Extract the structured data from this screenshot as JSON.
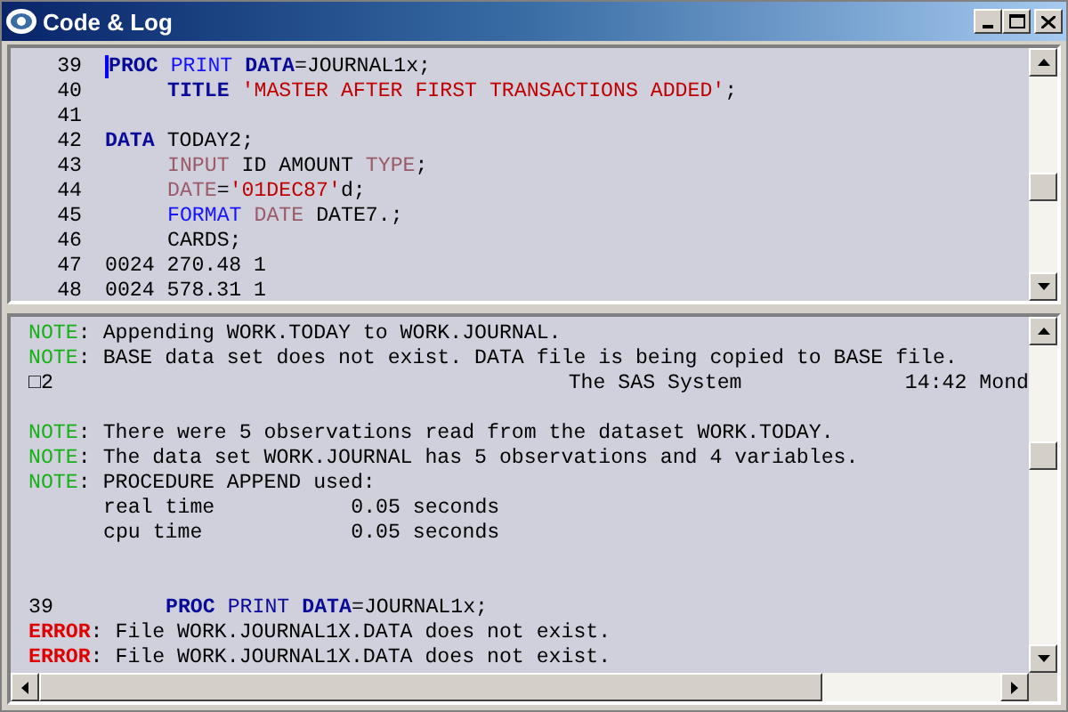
{
  "window": {
    "title": "Code & Log"
  },
  "code": {
    "lines": [
      {
        "number": "39",
        "indent": false,
        "cursor": true,
        "tokens": [
          {
            "text": "PROC",
            "kind": "step",
            "attached": true
          },
          {
            "text": "PRINT",
            "kind": "statement",
            "attached": false
          },
          {
            "text": "DATA",
            "kind": "step",
            "attached": false
          },
          {
            "text": "=JOURNAL1x;",
            "kind": "plain",
            "attached": true
          }
        ]
      },
      {
        "number": "40",
        "indent": true,
        "cursor": false,
        "tokens": [
          {
            "text": "TITLE",
            "kind": "step",
            "attached": true
          },
          {
            "text": "'MASTER AFTER FIRST TRANSACTIONS ADDED'",
            "kind": "string",
            "attached": false
          },
          {
            "text": ";",
            "kind": "plain",
            "attached": true
          }
        ]
      },
      {
        "number": "41",
        "cursor": false
      },
      {
        "number": "42",
        "indent": false,
        "cursor": false,
        "tokens": [
          {
            "text": "DATA",
            "kind": "step",
            "attached": true
          },
          {
            "text": "TODAY2;",
            "kind": "plain",
            "attached": false
          }
        ]
      },
      {
        "number": "43",
        "indent": true,
        "cursor": false,
        "tokens": [
          {
            "text": "INPUT",
            "kind": "variable",
            "attached": true
          },
          {
            "text": "ID AMOUNT",
            "kind": "plain",
            "attached": false
          },
          {
            "text": "TYPE",
            "kind": "variable",
            "attached": false
          },
          {
            "text": ";",
            "kind": "plain",
            "attached": true
          }
        ]
      },
      {
        "number": "44",
        "indent": true,
        "cursor": false,
        "tokens": [
          {
            "text": "DATE",
            "kind": "variable",
            "attached": true
          },
          {
            "text": "=",
            "kind": "plain",
            "attached": true
          },
          {
            "text": "'01DEC87'",
            "kind": "string",
            "attached": true
          },
          {
            "text": "d;",
            "kind": "plain",
            "attached": true
          }
        ]
      },
      {
        "number": "45",
        "indent": true,
        "cursor": false,
        "tokens": [
          {
            "text": "FORMAT",
            "kind": "statement",
            "attached": true
          },
          {
            "text": "DATE",
            "kind": "variable",
            "attached": false
          },
          {
            "text": "DATE7.;",
            "kind": "plain",
            "attached": false
          }
        ]
      },
      {
        "number": "46",
        "indent": true,
        "cursor": false,
        "tokens": [
          {
            "text": "CARDS;",
            "kind": "plain",
            "attached": true
          }
        ]
      },
      {
        "number": "47",
        "indent": false,
        "cursor": false,
        "tokens": [
          {
            "text": "0024 270.48 1",
            "kind": "plain",
            "attached": true
          }
        ]
      },
      {
        "number": "48",
        "indent": false,
        "cursor": false,
        "tokens": [
          {
            "text": "0024 578.31 1",
            "kind": "plain",
            "attached": true
          }
        ]
      }
    ]
  },
  "log": {
    "lines": [
      {
        "kind": "note",
        "label": "NOTE",
        "separator": ":",
        "text": "Appending WORK.TODAY to WORK.JOURNAL."
      },
      {
        "kind": "note",
        "label": "NOTE",
        "separator": ":",
        "text": "BASE data set does not exist. DATA file is being copied to BASE file."
      },
      {
        "kind": "header",
        "page": "□2",
        "title": "The SAS System",
        "time": "14:42 Mond"
      },
      {
        "kind": "blank"
      },
      {
        "kind": "note",
        "label": "NOTE",
        "separator": ":",
        "text": "There were 5 observations read from the dataset WORK.TODAY."
      },
      {
        "kind": "note",
        "label": "NOTE",
        "separator": ":",
        "text": "The data set WORK.JOURNAL has 5 observations and 4 variables."
      },
      {
        "kind": "note",
        "label": "NOTE",
        "separator": ":",
        "text": "PROCEDURE APPEND used:"
      },
      {
        "kind": "detail",
        "text": "real time           0.05 seconds"
      },
      {
        "kind": "detail",
        "text": "cpu time            0.05 seconds"
      },
      {
        "kind": "blank"
      },
      {
        "kind": "blank"
      },
      {
        "kind": "echo",
        "number": "39",
        "tokens": [
          {
            "text": "PROC",
            "kind": "step",
            "attached": true
          },
          {
            "text": "PRINT",
            "kind": "echo",
            "attached": false
          },
          {
            "text": "DATA",
            "kind": "step",
            "attached": false
          },
          {
            "text": "=JOURNAL1x;",
            "kind": "plain",
            "attached": true
          }
        ]
      },
      {
        "kind": "error",
        "label": "ERROR",
        "separator": ":",
        "text": "File WORK.JOURNAL1X.DATA does not exist."
      },
      {
        "kind": "error",
        "label": "ERROR",
        "separator": ":",
        "text": "File WORK.JOURNAL1X.DATA does not exist."
      }
    ]
  }
}
